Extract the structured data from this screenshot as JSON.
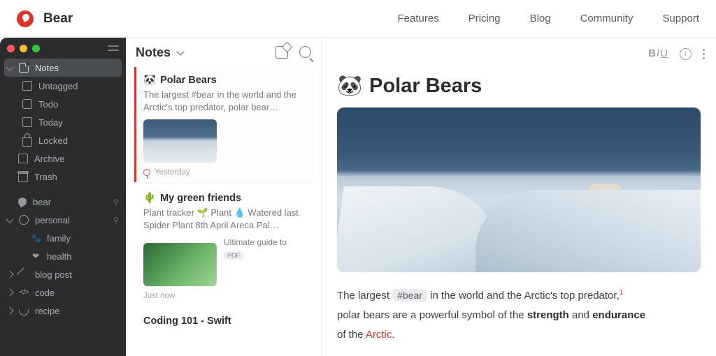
{
  "site": {
    "brand": "Bear",
    "nav": [
      "Features",
      "Pricing",
      "Blog",
      "Community",
      "Support"
    ]
  },
  "sidebar": {
    "primary": [
      {
        "label": "Notes"
      },
      {
        "label": "Untagged"
      },
      {
        "label": "Todo"
      },
      {
        "label": "Today"
      },
      {
        "label": "Locked"
      }
    ],
    "secondary": [
      {
        "label": "Archive"
      },
      {
        "label": "Trash"
      }
    ],
    "tags": [
      {
        "label": "bear"
      },
      {
        "label": "personal"
      },
      {
        "label": "family"
      },
      {
        "label": "health"
      },
      {
        "label": "blog post"
      },
      {
        "label": "code"
      },
      {
        "label": "recipe"
      }
    ]
  },
  "notesHeader": {
    "title": "Notes"
  },
  "notes": [
    {
      "emoji": "🐼",
      "title": "Polar Bears",
      "preview": "The largest #bear in the world and the Arctic's top predator, polar bear…",
      "date": "Yesterday"
    },
    {
      "emoji": "🌵",
      "title": "My green friends",
      "preview": "Plant tracker 🌱 Plant 💧 Watered last Spider Plant 8th April Areca Pal…",
      "attachment": {
        "title": "Ultimate guide to",
        "type": "PDF"
      },
      "date": "Just now"
    },
    {
      "title": "Coding 101 - Swift"
    }
  ],
  "editor": {
    "emoji": "🐼",
    "title": "Polar Bears",
    "body": {
      "p1a": "The largest ",
      "tag": "#bear",
      "p1b": " in the world and the Arctic's top predator,",
      "sup": "1",
      "p2a": "polar bears are a powerful symbol of the ",
      "strong1": "strength",
      "p2b": " and ",
      "strong2": "endurance",
      "p3a": "of the ",
      "arctic": "Arctic",
      "p3b": "."
    }
  }
}
